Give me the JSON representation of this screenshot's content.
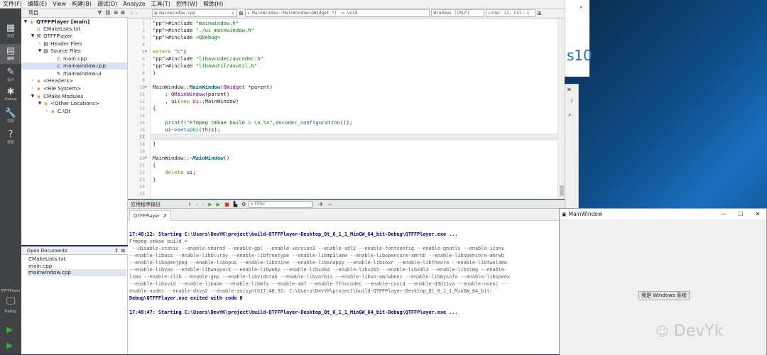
{
  "menu": [
    "文件(F)",
    "编辑(E)",
    "View",
    "构建(B)",
    "调试(D)",
    "Analyze",
    "工具(T)",
    "控件(W)",
    "帮助(H)"
  ],
  "modes": [
    {
      "icon": "grid-icon",
      "label": "欢迎",
      "glyph": "▦"
    },
    {
      "icon": "edit-icon",
      "label": "编辑",
      "glyph": "▤"
    },
    {
      "icon": "design-icon",
      "label": "设计",
      "glyph": "✎"
    },
    {
      "icon": "debug-icon",
      "label": "Debug",
      "glyph": "✱"
    },
    {
      "icon": "wrench-icon",
      "label": "项目",
      "glyph": "🔧"
    },
    {
      "icon": "help-icon",
      "label": "帮助",
      "glyph": "?"
    }
  ],
  "kit": {
    "project": "QTFFPlayer",
    "mode": "Debug"
  },
  "project_panel": {
    "title": "项目"
  },
  "tree": [
    {
      "label": "QTFFPlayer [main]",
      "bold": true,
      "arrow": "▼",
      "icon": "▪"
    },
    {
      "label": "CMakeLists.txt",
      "arrow": "",
      "icon": "▫"
    },
    {
      "label": "QTFFPlayer",
      "arrow": "▼",
      "icon": "⚒"
    },
    {
      "label": "Header Files",
      "arrow": "›",
      "icon": "▤"
    },
    {
      "label": "Source Files",
      "arrow": "▼",
      "icon": "▤"
    },
    {
      "label": "main.cpp",
      "arrow": "",
      "icon": "c"
    },
    {
      "label": "mainwindow.cpp",
      "arrow": "",
      "icon": "c"
    },
    {
      "label": "mainwindow.ui",
      "arrow": "",
      "icon": "✎"
    },
    {
      "label": "<Headers>",
      "arrow": "›",
      "icon": "▪"
    },
    {
      "label": "<File System>",
      "arrow": "›",
      "icon": "▪"
    },
    {
      "label": "CMake Modules",
      "arrow": "▼",
      "icon": "▪"
    },
    {
      "label": "<Other Locations>",
      "arrow": "▼",
      "icon": "▪"
    },
    {
      "label": "C:\\Qt",
      "arrow": "›",
      "icon": "▪"
    }
  ],
  "open_documents": {
    "title": "Open Documents",
    "items": [
      "CMakeLists.txt",
      "main.cpp",
      "mainwindow.cpp"
    ]
  },
  "editor": {
    "file": "mainwindow.cpp",
    "symbol": "MainWindow::MainWindow(QWidget *) -> void",
    "encoding": "Windows (CRLF)",
    "position": "Line: 17, Col: 1",
    "current_line": 17,
    "lines": [
      "#include \"mainwindow.h\"",
      "#include \"./ui_mainwindow.h\"",
      "#include <QDebug>",
      "",
      "extern \"C\"{",
      "#include \"libavcodec/avcodec.h\"",
      "#include \"libavutil/avutil.h\"",
      "}",
      "",
      "MainWindow::MainWindow(QWidget *parent)",
      "    : QMainWindow(parent)",
      "    , ui(new Ui::MainWindow)",
      "{",
      "",
      "    printf(\"Ffmpeg cmkae build = \\n %s\",avcodec_configuration());",
      "    ui->setupUi(this);",
      "",
      "}",
      "",
      "MainWindow::~MainWindow()",
      "{",
      "    delete ui;",
      "}",
      "",
      "",
      ""
    ]
  },
  "output_panel": {
    "title": "应用程序输出",
    "filter_placeholder": "Filter",
    "tab": "QTFFPlayer",
    "lines": [
      {
        "t": "",
        "b": false
      },
      {
        "t": "17:48:12: Starting C:\\Users\\DevYK\\project\\build-QTFFPlayer-Desktop_Qt_6_1_1_MinGW_64_bit-Debug\\QTFFPlayer.exe ...",
        "b": true
      },
      {
        "t": "Ffmpeg cmkae build =",
        "b": false
      },
      {
        "t": " --disable-static --enable-shared --enable-gpl --enable-version3 --enable-sdl2 --enable-fontconfig --enable-gnutls --enable-iconv",
        "b": false
      },
      {
        "t": "--enable-libass --enable-libbluray --enable-libfreetype --enable-libmp3lame --enable-libopencore-amrnb --enable-libopencore-amrwb",
        "b": false
      },
      {
        "t": "--enable-libopenjpeg --enable-libopus --enable-libshine --enable-libsnappy --enable-libsoxr --enable-libtheora --enable-libtwolame",
        "b": false
      },
      {
        "t": "--enable-libvpx --enable-libwavpack --enable-libwebp --enable-libx264 --enable-libx265 --enable-libxml2 --enable-libzimg --enable-",
        "b": false
      },
      {
        "t": "lzma --enable-zlib --enable-gmp --enable-libvidstab --enable-libvorbis --enable-libvo-amrwbenc --enable-libmysofa --enable-libspeex",
        "b": false
      },
      {
        "t": "--enable-libxvid --enable-libaom --enable-libmfx --enable-amf --enable-ffnvcodec --enable-cuvid --enable-d3d11va --enable-nvenc --",
        "b": false
      },
      {
        "t": "enable-nvdec --enable-dxva2 --enable-avisynth17:48:31: C:\\Users\\DevYK\\project\\build-QTFFPlayer-Desktop_Qt_6_1_1_MinGW_64_bit-",
        "b": false
      },
      {
        "t": "Debug\\QTFFPlayer.exe exited with code 0",
        "b": true
      },
      {
        "t": "",
        "b": false
      },
      {
        "t": "17:48:47: Starting C:\\Users\\DevYK\\project\\build-QTFFPlayer-Desktop_Qt_6_1_1_MinGW_64_bit-Debug\\QTFFPlayer.exe ...",
        "b": true
      }
    ]
  },
  "desktop": {
    "brand_fragment": "s10"
  },
  "app_window": {
    "title": "MainWindow",
    "button": "我是 Windows 系统",
    "watermark": "DevYk"
  }
}
